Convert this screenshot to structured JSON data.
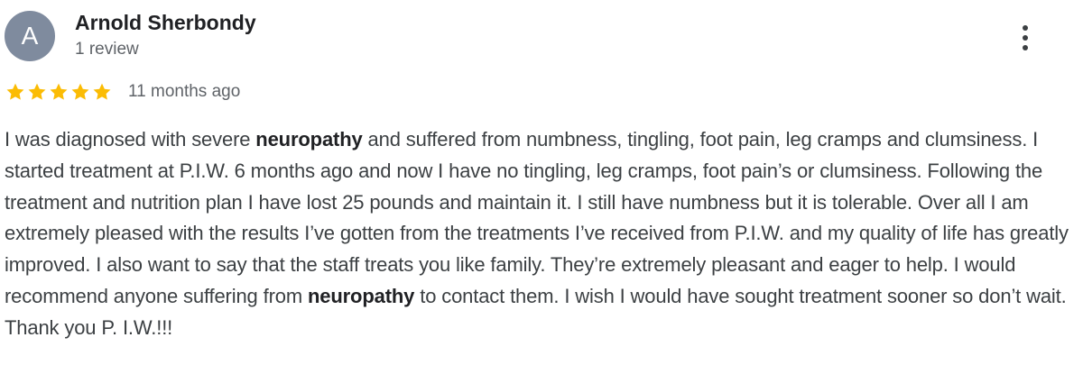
{
  "reviewer": {
    "initial": "A",
    "avatar_color": "#7f8b9e",
    "name": "Arnold Sherbondy",
    "review_count": "1 review"
  },
  "menu": {
    "icon": "more-vertical-icon"
  },
  "rating": {
    "stars": 5,
    "max_stars": 5,
    "star_color": "#fbbc04",
    "date": "11 months ago"
  },
  "review": {
    "segments": [
      {
        "text": "I was diagnosed with severe ",
        "bold": false
      },
      {
        "text": "neuropathy",
        "bold": true
      },
      {
        "text": " and suffered from numbness, tingling, foot pain, leg cramps and clumsiness. I started treatment at P.I.W. 6 months ago and now I have no tingling, leg cramps, foot pain’s or clumsiness. Following the treatment and nutrition plan I have lost 25 pounds and maintain it. I still have numbness but it is tolerable. Over all I am extremely pleased with the results I’ve gotten from the treatments I’ve received from P.I.W. and my quality of life has greatly improved. I also want to say that the staff treats you like family. They’re extremely pleasant and eager to help. I would recommend anyone suffering from ",
        "bold": false
      },
      {
        "text": "neuropathy",
        "bold": true
      },
      {
        "text": " to contact them. I wish I would have sought treatment sooner so don’t wait. Thank you P. I.W.!!!",
        "bold": false
      }
    ]
  }
}
